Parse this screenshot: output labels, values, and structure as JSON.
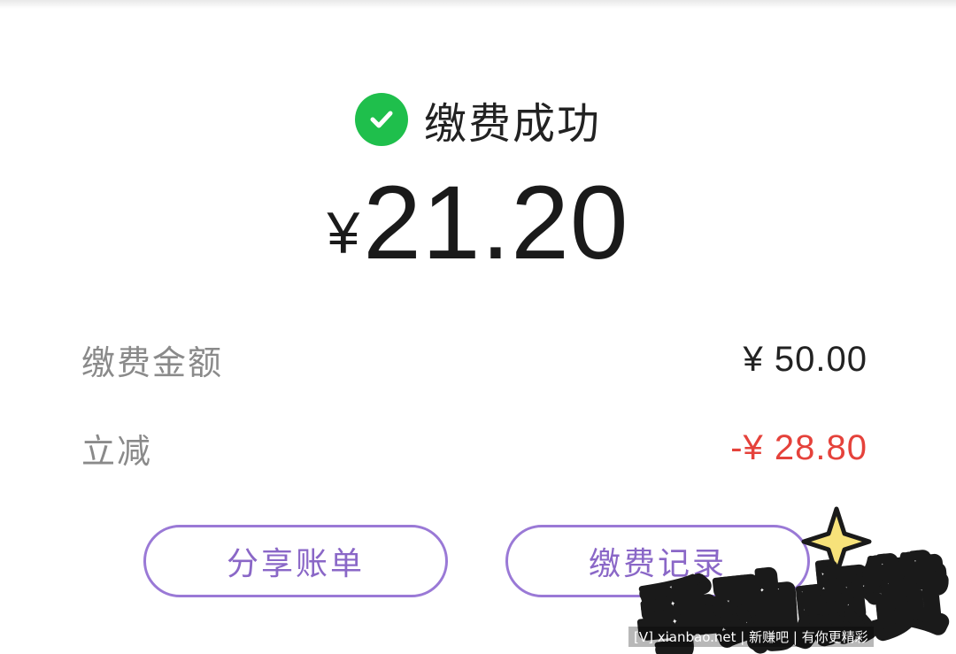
{
  "status": {
    "title": "缴费成功",
    "icon": "check-circle-icon",
    "icon_color": "#1fbf4c"
  },
  "amount": {
    "currency": "¥",
    "value": "21.20"
  },
  "details": [
    {
      "label": "缴费金额",
      "value": "¥ 50.00",
      "value_color": "#222222"
    },
    {
      "label": "立减",
      "value": "-¥ 28.80",
      "value_color": "#e5423b"
    }
  ],
  "buttons": {
    "share_label": "分享账单",
    "records_label": "缴费记录",
    "border_color": "#9a79d6"
  },
  "sticker": {
    "text": "手动点赞",
    "icon": "sparkle-icon"
  },
  "watermark": {
    "text": "[V] xianbao.net | 新赚吧 | 有你更精彩"
  }
}
